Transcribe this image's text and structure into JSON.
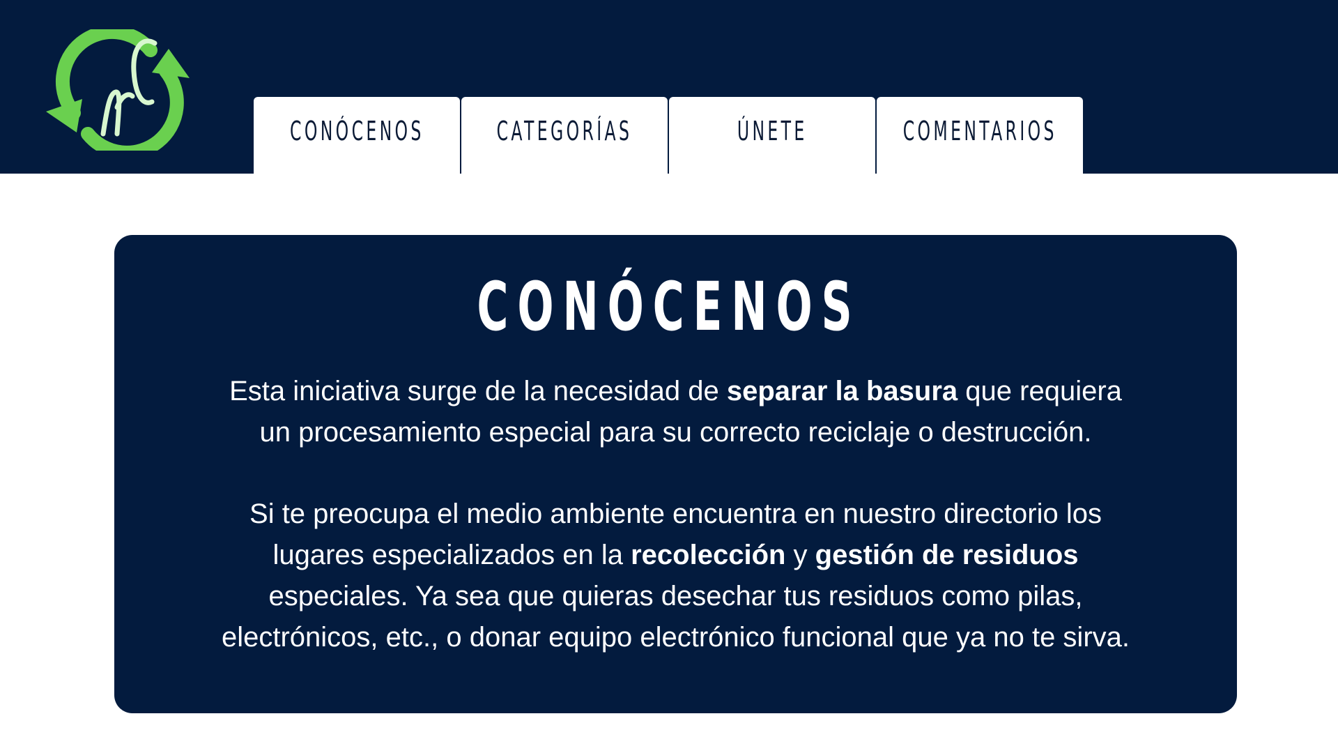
{
  "header": {
    "logo_text": "nc",
    "tabs": [
      {
        "label": "CONÓCENOS"
      },
      {
        "label": "CATEGORÍAS"
      },
      {
        "label": "ÚNETE"
      },
      {
        "label": "COMENTARIOS"
      }
    ]
  },
  "main": {
    "title": "CONÓCENOS",
    "paragraph1": {
      "line1_before": "Esta iniciativa surge de la necesidad de ",
      "line1_bold": "separar la basura",
      "line1_after": " que requiera",
      "line2": "un procesamiento especial para su correcto reciclaje o destrucción."
    },
    "paragraph2": {
      "line1": "Si te preocupa el medio ambiente encuentra en nuestro directorio los",
      "line2_before": "lugares especializados en la ",
      "line2_bold1": "recolección",
      "line2_mid": " y ",
      "line2_bold2": "gestión de residuos",
      "line3": "especiales. Ya sea que quieras desechar tus residuos como pilas,",
      "line4": "electrónicos, etc., o donar equipo electrónico funcional que ya no te sirva."
    }
  },
  "colors": {
    "navy": "#031b3e",
    "logo_green": "#6ad04f",
    "logo_light_green": "#c9f5c0",
    "white": "#ffffff"
  }
}
